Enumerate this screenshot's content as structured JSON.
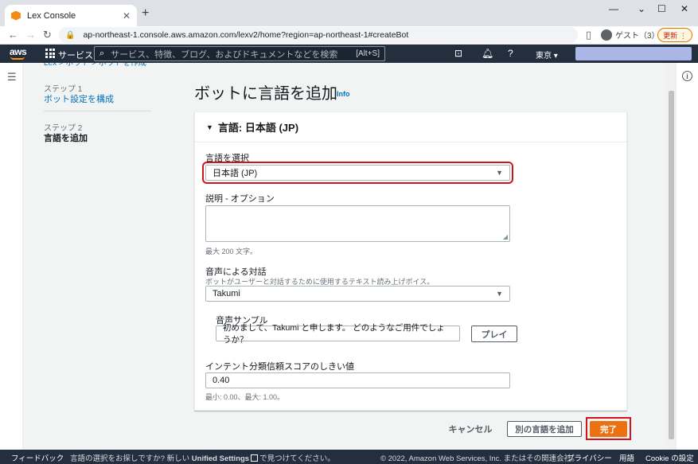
{
  "browser": {
    "tab_title": "Lex Console",
    "tab_close": "✕",
    "new_tab": "+",
    "min": "—",
    "max": "☐",
    "close": "✕",
    "url": "ap-northeast-1.console.aws.amazon.com/lexv2/home?region=ap-northeast-1#createBot",
    "profile_label": "ゲスト（3）",
    "update_label": "更新 ⋮"
  },
  "aws_nav": {
    "logo": "aws",
    "services_label": "サービス",
    "search_placeholder": "サービス、特徴、ブログ、およびドキュメントなどを検索",
    "search_shortcut": "[Alt+S]",
    "region": "東京 ▾"
  },
  "steps": {
    "crumb": "Lex  >  ボット  >  ボットを作成",
    "step1_sub": "ステップ 1",
    "step1_label": "ボット設定を構成",
    "step2_sub": "ステップ 2",
    "step2_label": "言語を追加"
  },
  "main": {
    "title": "ボットに言語を追加",
    "info": "Info",
    "panel_title": "言語: 日本語 (JP)",
    "language_label": "言語を選択",
    "language_value": "日本語 (JP)",
    "description_label": "説明 - オプション",
    "description_hint": "最大 200 文字。",
    "voice_label": "音声による対話",
    "voice_desc": "ボットがユーザーと対話するために使用するテキスト読み上げボイス。",
    "voice_value": "Takumi",
    "sample_label": "音声サンプル",
    "sample_text": "初めまして、Takumi と申します。 どのようなご用件でしょうか？",
    "play_label": "プレイ",
    "threshold_label": "インテント分類信頼スコアのしきい値",
    "threshold_value": "0.40",
    "threshold_hint": "最小: 0.00、最大: 1.00。"
  },
  "actions": {
    "cancel": "キャンセル",
    "add_language": "別の言語を追加",
    "done": "完了"
  },
  "footer": {
    "feedback": "フィードバック",
    "lang_prompt": "言語の選択をお探しですか? 新しい",
    "unified": "Unified Settings",
    "lang_suffix": "で見つけてください。",
    "copyright": "© 2022, Amazon Web Services, Inc. またはその関連会社。",
    "privacy": "プライバシー",
    "terms": "用語",
    "cookie": "Cookie の設定"
  },
  "colors": {
    "aws_nav": "#232f3e",
    "primary_button": "#ec7211",
    "highlight": "#d0141b",
    "link": "#0073bb"
  }
}
